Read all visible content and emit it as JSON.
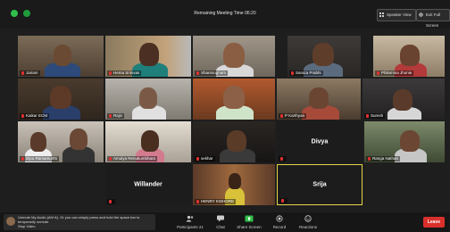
{
  "header": {
    "timer": "Remaining Meeting Time 06:20",
    "speaker_view": "Speaker View",
    "exit_fullscreen": "Exit Full Screen"
  },
  "participants": [
    {
      "name": "Jairam",
      "muted": true
    },
    {
      "name": "Hema Srinivas",
      "muted": true
    },
    {
      "name": "Shanmugham",
      "muted": true
    },
    {
      "name": "Saraza Prabhi",
      "muted": true
    },
    {
      "name": "Philomina Jhonie",
      "muted": true
    },
    {
      "name": "Kaikar ECM",
      "muted": true
    },
    {
      "name": "Rajiv",
      "muted": true
    },
    {
      "name": "",
      "muted": false
    },
    {
      "name": "P Karthyan",
      "muted": true
    },
    {
      "name": "Suresh",
      "muted": true
    },
    {
      "name": "Dipu Ramamurthi",
      "muted": true
    },
    {
      "name": "Amulya Renukumbhara",
      "muted": true
    },
    {
      "name": "sekhar",
      "muted": true
    },
    {
      "name": "Divya",
      "muted": true
    },
    {
      "name": "Ranga Nathan",
      "muted": true
    },
    {
      "name": "Willander",
      "muted": true
    },
    {
      "name": "HENRY KISHORE",
      "muted": true
    },
    {
      "name": "Srija",
      "muted": true
    }
  ],
  "notice": {
    "text": "Unmute My Audio (Alt+A). Or you can simply press and hold the space bar to temporarily unmute.",
    "sub": "Stop Video"
  },
  "toolbar": {
    "unmute": "Unmute",
    "participants": "Participants",
    "participants_count": "21",
    "chat": "Chat",
    "share_screen": "Share Screen",
    "record": "Record",
    "reactions": "Reactions",
    "leave": "Leave"
  },
  "colors": {
    "active_speaker": "#e8d44a",
    "leave": "#d9302c",
    "share": "#2fbf4a",
    "muted": "#e03030"
  }
}
